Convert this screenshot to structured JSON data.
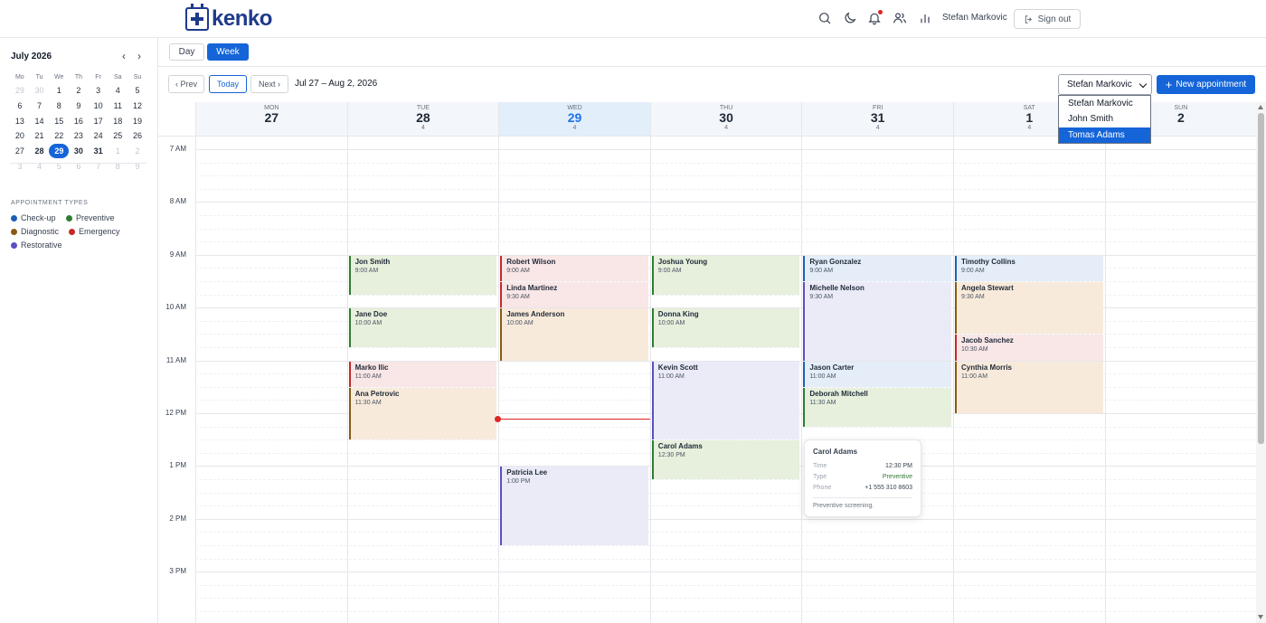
{
  "app": {
    "brand": "kenko"
  },
  "header": {
    "user_name": "Stefan Markovic",
    "sign_out_label": "Sign out"
  },
  "mini_calendar": {
    "title": "July 2026",
    "prev": "‹",
    "next": "›",
    "weekdays": [
      "Mo",
      "Tu",
      "We",
      "Th",
      "Fr",
      "Sa",
      "Su"
    ],
    "days": [
      {
        "d": "29",
        "out": true
      },
      {
        "d": "30",
        "out": true
      },
      {
        "d": "1"
      },
      {
        "d": "2"
      },
      {
        "d": "3"
      },
      {
        "d": "4"
      },
      {
        "d": "5"
      },
      {
        "d": "6"
      },
      {
        "d": "7"
      },
      {
        "d": "8"
      },
      {
        "d": "9"
      },
      {
        "d": "10"
      },
      {
        "d": "11"
      },
      {
        "d": "12"
      },
      {
        "d": "13"
      },
      {
        "d": "14"
      },
      {
        "d": "15"
      },
      {
        "d": "16"
      },
      {
        "d": "17"
      },
      {
        "d": "18"
      },
      {
        "d": "19"
      },
      {
        "d": "20"
      },
      {
        "d": "21"
      },
      {
        "d": "22"
      },
      {
        "d": "23"
      },
      {
        "d": "24"
      },
      {
        "d": "25"
      },
      {
        "d": "26"
      },
      {
        "d": "27"
      },
      {
        "d": "28",
        "bold": true
      },
      {
        "d": "29",
        "selected": true
      },
      {
        "d": "30",
        "bold": true
      },
      {
        "d": "31",
        "bold": true
      },
      {
        "d": "1",
        "out": true
      },
      {
        "d": "2",
        "out": true
      },
      {
        "d": "3",
        "out": true
      },
      {
        "d": "4",
        "out": true
      },
      {
        "d": "5",
        "out": true
      },
      {
        "d": "6",
        "out": true
      },
      {
        "d": "7",
        "out": true
      },
      {
        "d": "8",
        "out": true
      },
      {
        "d": "9",
        "out": true
      }
    ]
  },
  "appointment_types": {
    "title": "APPOINTMENT TYPES",
    "items": [
      {
        "label": "Check-up",
        "color": "#1d5fb5"
      },
      {
        "label": "Preventive",
        "color": "#2e7d32"
      },
      {
        "label": "Diagnostic",
        "color": "#8a5a13"
      },
      {
        "label": "Emergency",
        "color": "#c62828"
      },
      {
        "label": "Restorative",
        "color": "#5b4fc2"
      }
    ]
  },
  "view_toggle": {
    "day_label": "Day",
    "week_label": "Week",
    "active": "Week"
  },
  "nav": {
    "prev_label": "‹ Prev",
    "today_label": "Today",
    "next_label": "Next ›",
    "range_label": "Jul 27 – Aug 2, 2026"
  },
  "provider_select": {
    "value": "Stefan Markovic",
    "options": [
      "Stefan Markovic",
      "John Smith",
      "Tomas Adams"
    ],
    "highlighted": "Tomas Adams"
  },
  "new_appointment_label": "New appointment",
  "days": [
    {
      "name": "MON",
      "num": "27",
      "count": ""
    },
    {
      "name": "TUE",
      "num": "28",
      "count": "4"
    },
    {
      "name": "WED",
      "num": "29",
      "count": "4",
      "today": true
    },
    {
      "name": "THU",
      "num": "30",
      "count": "4"
    },
    {
      "name": "FRI",
      "num": "31",
      "count": "4"
    },
    {
      "name": "SAT",
      "num": "1",
      "count": "4"
    },
    {
      "name": "SUN",
      "num": "2",
      "count": ""
    }
  ],
  "hours": [
    "7 AM",
    "8 AM",
    "9 AM",
    "10 AM",
    "11 AM",
    "12 PM",
    "1 PM",
    "2 PM",
    "3 PM"
  ],
  "type_colors": {
    "preventive": {
      "bg": "#e6f0dd",
      "border": "#2e7d32"
    },
    "emergency": {
      "bg": "#f9e6e6",
      "border": "#c62828"
    },
    "diagnostic": {
      "bg": "#f8eadb",
      "border": "#8a5a13"
    },
    "restorative": {
      "bg": "#ebebf8",
      "border": "#5b4fc2"
    },
    "checkup": {
      "bg": "#e4edf8",
      "border": "#1d5fb5"
    }
  },
  "appointments": [
    {
      "day": 1,
      "name": "Jon Smith",
      "time": "9:00 AM",
      "start": 9.0,
      "end": 9.75,
      "type": "preventive"
    },
    {
      "day": 1,
      "name": "Jane Doe",
      "time": "10:00 AM",
      "start": 10.0,
      "end": 10.75,
      "type": "preventive"
    },
    {
      "day": 1,
      "name": "Marko Ilic",
      "time": "11:00 AM",
      "start": 11.0,
      "end": 11.5,
      "type": "emergency"
    },
    {
      "day": 1,
      "name": "Ana Petrovic",
      "time": "11:30 AM",
      "start": 11.5,
      "end": 12.5,
      "type": "diagnostic"
    },
    {
      "day": 2,
      "name": "Robert Wilson",
      "time": "9:00 AM",
      "start": 9.0,
      "end": 9.5,
      "type": "emergency"
    },
    {
      "day": 2,
      "name": "Linda Martinez",
      "time": "9:30 AM",
      "start": 9.5,
      "end": 10.0,
      "type": "emergency"
    },
    {
      "day": 2,
      "name": "James Anderson",
      "time": "10:00 AM",
      "start": 10.0,
      "end": 11.0,
      "type": "diagnostic"
    },
    {
      "day": 2,
      "name": "Patricia Lee",
      "time": "1:00 PM",
      "start": 13.0,
      "end": 14.5,
      "type": "restorative"
    },
    {
      "day": 3,
      "name": "Joshua Young",
      "time": "9:00 AM",
      "start": 9.0,
      "end": 9.75,
      "type": "preventive"
    },
    {
      "day": 3,
      "name": "Donna King",
      "time": "10:00 AM",
      "start": 10.0,
      "end": 10.75,
      "type": "preventive"
    },
    {
      "day": 3,
      "name": "Kevin Scott",
      "time": "11:00 AM",
      "start": 11.0,
      "end": 12.5,
      "type": "restorative"
    },
    {
      "day": 3,
      "name": "Carol Adams",
      "time": "12:30 PM",
      "start": 12.5,
      "end": 13.25,
      "type": "preventive"
    },
    {
      "day": 4,
      "name": "Ryan Gonzalez",
      "time": "9:00 AM",
      "start": 9.0,
      "end": 9.5,
      "type": "checkup"
    },
    {
      "day": 4,
      "name": "Michelle Nelson",
      "time": "9:30 AM",
      "start": 9.5,
      "end": 11.0,
      "type": "restorative"
    },
    {
      "day": 4,
      "name": "Jason Carter",
      "time": "11:00 AM",
      "start": 11.0,
      "end": 11.5,
      "type": "checkup"
    },
    {
      "day": 4,
      "name": "Deborah Mitchell",
      "time": "11:30 AM",
      "start": 11.5,
      "end": 12.25,
      "type": "preventive"
    },
    {
      "day": 5,
      "name": "Timothy Collins",
      "time": "9:00 AM",
      "start": 9.0,
      "end": 9.5,
      "type": "checkup"
    },
    {
      "day": 5,
      "name": "Angela Stewart",
      "time": "9:30 AM",
      "start": 9.5,
      "end": 10.5,
      "type": "diagnostic"
    },
    {
      "day": 5,
      "name": "Jacob Sanchez",
      "time": "10:30 AM",
      "start": 10.5,
      "end": 11.0,
      "type": "emergency"
    },
    {
      "day": 5,
      "name": "Cynthia Morris",
      "time": "11:00 AM",
      "start": 11.0,
      "end": 12.0,
      "type": "diagnostic"
    }
  ],
  "now_indicator": {
    "day": 2,
    "hour": 12.1
  },
  "popup": {
    "title": "Carol Adams",
    "rows": [
      {
        "key": "Time",
        "value": "12:30 PM"
      },
      {
        "key": "Type",
        "value": "Preventive",
        "color": "#2e7d32"
      },
      {
        "key": "Phone",
        "value": "+1 555 310 8603"
      }
    ],
    "note": "Preventive screening."
  }
}
